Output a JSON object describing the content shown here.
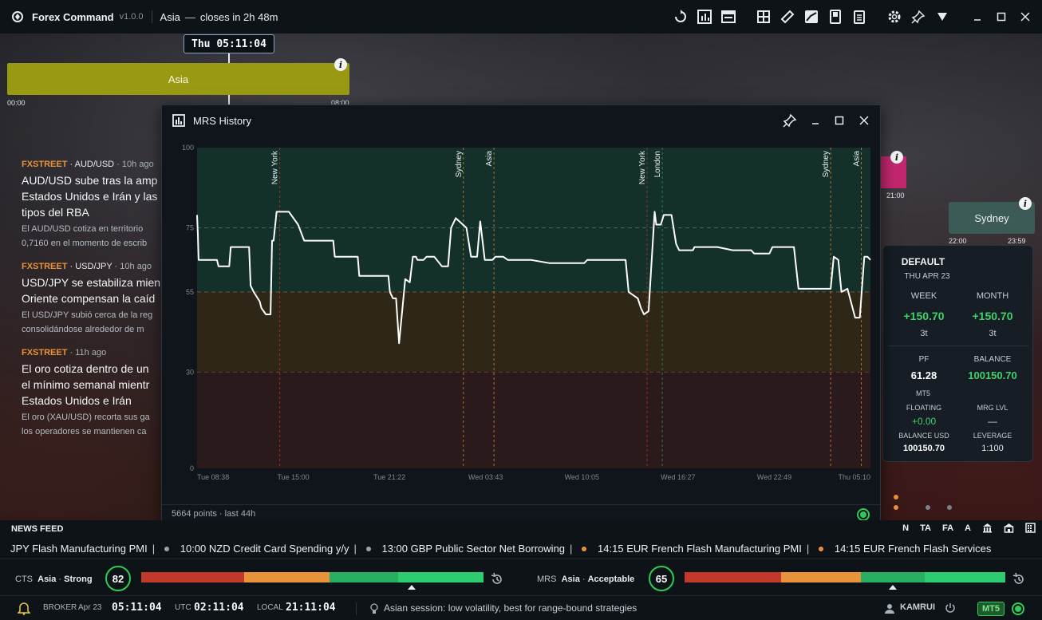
{
  "titlebar": {
    "app_name": "Forex Command",
    "version": "v1.0.0",
    "session": "Asia",
    "dash": "—",
    "closes_in": "closes in 2h 48m",
    "icons": [
      "sync-icon",
      "bar-chart-icon",
      "calendar-icon",
      "grid-icon",
      "ruler-icon",
      "image-icon",
      "book-icon",
      "notes-icon",
      "gear-icon",
      "pin-icon",
      "filter-icon",
      "minimize-icon",
      "maximize-icon",
      "close-icon"
    ]
  },
  "timeline": {
    "current_time": "Thu 05:11:04",
    "asia_label": "Asia",
    "asia_start": "00:00",
    "asia_end": "08:00",
    "mid_label_time": "21:00",
    "sydney_label": "Sydney",
    "sydney_start": "22:00",
    "sydney_end": "23:59"
  },
  "news": [
    {
      "source": "FXSTREET",
      "pair": "AUD/USD",
      "ago": "10h ago",
      "title": [
        "AUD/USD sube tras la amp",
        "Estados Unidos e Irán y las",
        "tipos del RBA"
      ],
      "summary": [
        "El AUD/USD cotiza en territorio",
        "0,7160 en el momento de escrib"
      ]
    },
    {
      "source": "FXSTREET",
      "pair": "USD/JPY",
      "ago": "10h ago",
      "title": [
        "USD/JPY se estabiliza mien",
        "Oriente compensan la caíd"
      ],
      "summary": [
        "El USD/JPY subió cerca de la reg",
        "consolidándose alrededor de m"
      ]
    },
    {
      "source": "FXSTREET",
      "pair": "",
      "ago": "11h ago",
      "title": [
        "El oro cotiza dentro de un",
        "el mínimo semanal mientr",
        "Estados Unidos e Irán"
      ],
      "summary": [
        "El oro (XAU/USD) recorta sus ga",
        "los operadores se mantienen ca"
      ]
    }
  ],
  "account": {
    "profile": "DEFAULT",
    "date": "THU  APR  23",
    "week_label": "WEEK",
    "month_label": "MONTH",
    "week_value": "+150.70",
    "month_value": "+150.70",
    "week_trades": "3t",
    "month_trades": "3t",
    "pf_label": "PF",
    "balance_label": "BALANCE",
    "pf_value": "61.28",
    "balance_value": "100150.70",
    "platform": "MT5",
    "floating_label": "FLOATING",
    "mrg_label": "MRG LVL",
    "floating_value": "+0.00",
    "mrg_value": "—",
    "balance_usd_label": "BALANCE USD",
    "leverage_label": "LEVERAGE",
    "balance_usd_value": "100150.70",
    "leverage_value": "1:100"
  },
  "mrs_window": {
    "title": "MRS History",
    "footer": "5664 points · last 44h",
    "colors": {
      "green_zone": "#14302a",
      "orange_zone": "#2e2617",
      "red_zone": "#2b1a1b",
      "line": "#ffffff"
    }
  },
  "chart_data": {
    "type": "line",
    "title": "",
    "xlabel": "",
    "ylabel": "",
    "ylim": [
      0,
      100
    ],
    "y_ticks": [
      0,
      30,
      55,
      75,
      100
    ],
    "zones": [
      {
        "from": 55,
        "to": 100,
        "label": "green"
      },
      {
        "from": 30,
        "to": 55,
        "label": "orange"
      },
      {
        "from": 0,
        "to": 30,
        "label": "red"
      }
    ],
    "x_ticks": [
      "Tue 08:38",
      "Tue 15:00",
      "Tue 21:22",
      "Wed 03:43",
      "Wed 10:05",
      "Wed 16:27",
      "Wed 22:49",
      "Thu 05:10"
    ],
    "x_range_hours": [
      0,
      44
    ],
    "events": [
      {
        "label": "New York",
        "hour": 5.4,
        "color": "#c0392b"
      },
      {
        "label": "Sydney",
        "hour": 17.4,
        "color": "#e8923a"
      },
      {
        "label": "Asia",
        "hour": 19.4,
        "color": "#e8923a"
      },
      {
        "label": "London",
        "hour": 30.4,
        "color": "#3c9a5f"
      },
      {
        "label": "New York",
        "hour": 29.4,
        "color": "#c0392b"
      },
      {
        "label": "Sydney",
        "hour": 41.4,
        "color": "#e8923a"
      },
      {
        "label": "Asia",
        "hour": 43.4,
        "color": "#e8923a"
      }
    ],
    "series": [
      {
        "name": "",
        "x": [
          0,
          0.05,
          0.1,
          1.3,
          1.4,
          2.1,
          2.2,
          3.4,
          3.5,
          3.7,
          4.1,
          4.2,
          4.5,
          4.8,
          4.9,
          5.0,
          5.2,
          5.3,
          5.5,
          5.8,
          6.0,
          6.6,
          7.0,
          8.0,
          8.9,
          9.0,
          10.5,
          10.6,
          12.5,
          12.6,
          12.8,
          13.0,
          13.2,
          13.6,
          13.9,
          14.1,
          14.3,
          14.4,
          14.5,
          14.8,
          15.0,
          15.5,
          16.0,
          16.4,
          16.6,
          16.9,
          17.6,
          17.9,
          18.3,
          18.5,
          18.8,
          19.3,
          19.5,
          20.0,
          20.3,
          20.6,
          20.8,
          21.0,
          21.2,
          21.4,
          21.6,
          21.8,
          23.0,
          23.1,
          25.3,
          25.5,
          28.0,
          28.2,
          28.8,
          29.0,
          29.2,
          29.5,
          29.9,
          30.0,
          30.3,
          30.5,
          31.0,
          31.3,
          31.5,
          32.4,
          32.5,
          33.0,
          34.0,
          35.0,
          36.2,
          36.4,
          37.4,
          37.6,
          39.0,
          39.3,
          41.4,
          41.6,
          41.9,
          42.1,
          42.5,
          43.0,
          43.3,
          43.6,
          43.8,
          44.0
        ],
        "y": [
          79,
          73,
          65,
          65,
          63,
          63,
          69,
          69,
          57,
          55,
          52,
          50,
          48,
          48,
          71,
          71,
          80,
          80,
          80,
          80,
          80,
          76,
          71,
          71,
          71,
          66,
          66,
          60,
          60,
          55,
          53,
          53,
          39,
          59,
          58,
          66,
          66,
          65,
          65,
          65,
          66,
          66,
          63,
          63,
          75,
          78,
          75,
          66,
          66,
          77,
          65,
          65,
          66,
          66,
          65,
          65,
          65,
          65,
          65,
          65,
          65,
          65,
          64,
          64,
          64,
          65,
          65,
          55,
          53,
          50,
          48,
          49,
          80,
          76,
          76,
          79,
          79,
          70,
          68,
          68,
          69,
          69,
          69,
          68,
          68,
          67,
          67,
          69,
          69,
          56,
          56,
          66,
          65,
          55,
          56,
          47,
          47,
          66,
          66,
          65
        ]
      }
    ]
  },
  "newsfeed": {
    "label": "NEWS FEED",
    "buttons": [
      "N",
      "TA",
      "FA",
      "A"
    ],
    "ticker": [
      {
        "text": "JPY  Flash Manufacturing PMI",
        "sep": "|",
        "dot": "#9aa3ab"
      },
      {
        "text": "10:00  NZD  Credit Card Spending y/y",
        "sep": "|",
        "dot": "#9aa3ab"
      },
      {
        "text": "13:00  GBP  Public Sector Net Borrowing",
        "sep": "|",
        "dot": "#e8923a"
      },
      {
        "text": "14:15  EUR  French Flash Manufacturing PMI",
        "sep": "|",
        "dot": "#e8923a"
      },
      {
        "text": "14:15  EUR  French Flash Services",
        "sep": "",
        "dot": ""
      }
    ]
  },
  "scores": {
    "cts_label": "CTS",
    "cts_session": "Asia",
    "cts_quality": "Strong",
    "cts_value": "82",
    "mrs_label": "MRS",
    "mrs_session": "Asia",
    "mrs_quality": "Acceptable",
    "mrs_value": "65",
    "cts_level": 0.79,
    "mrs_level": 0.65,
    "gauge_colors": [
      "#c0392b",
      "#e8923a",
      "#27ae60",
      "#2ecc71"
    ]
  },
  "statusbar": {
    "broker_label": "BROKER",
    "broker_date": "Apr  23",
    "broker_time": "05:11:04",
    "utc_label": "UTC",
    "utc_time": "02:11:04",
    "local_label": "LOCAL",
    "local_time": "21:11:04",
    "hint": "Asian session: low volatility, best for range-bound strategies",
    "user": "KAMRUI",
    "platform": "MT5"
  }
}
